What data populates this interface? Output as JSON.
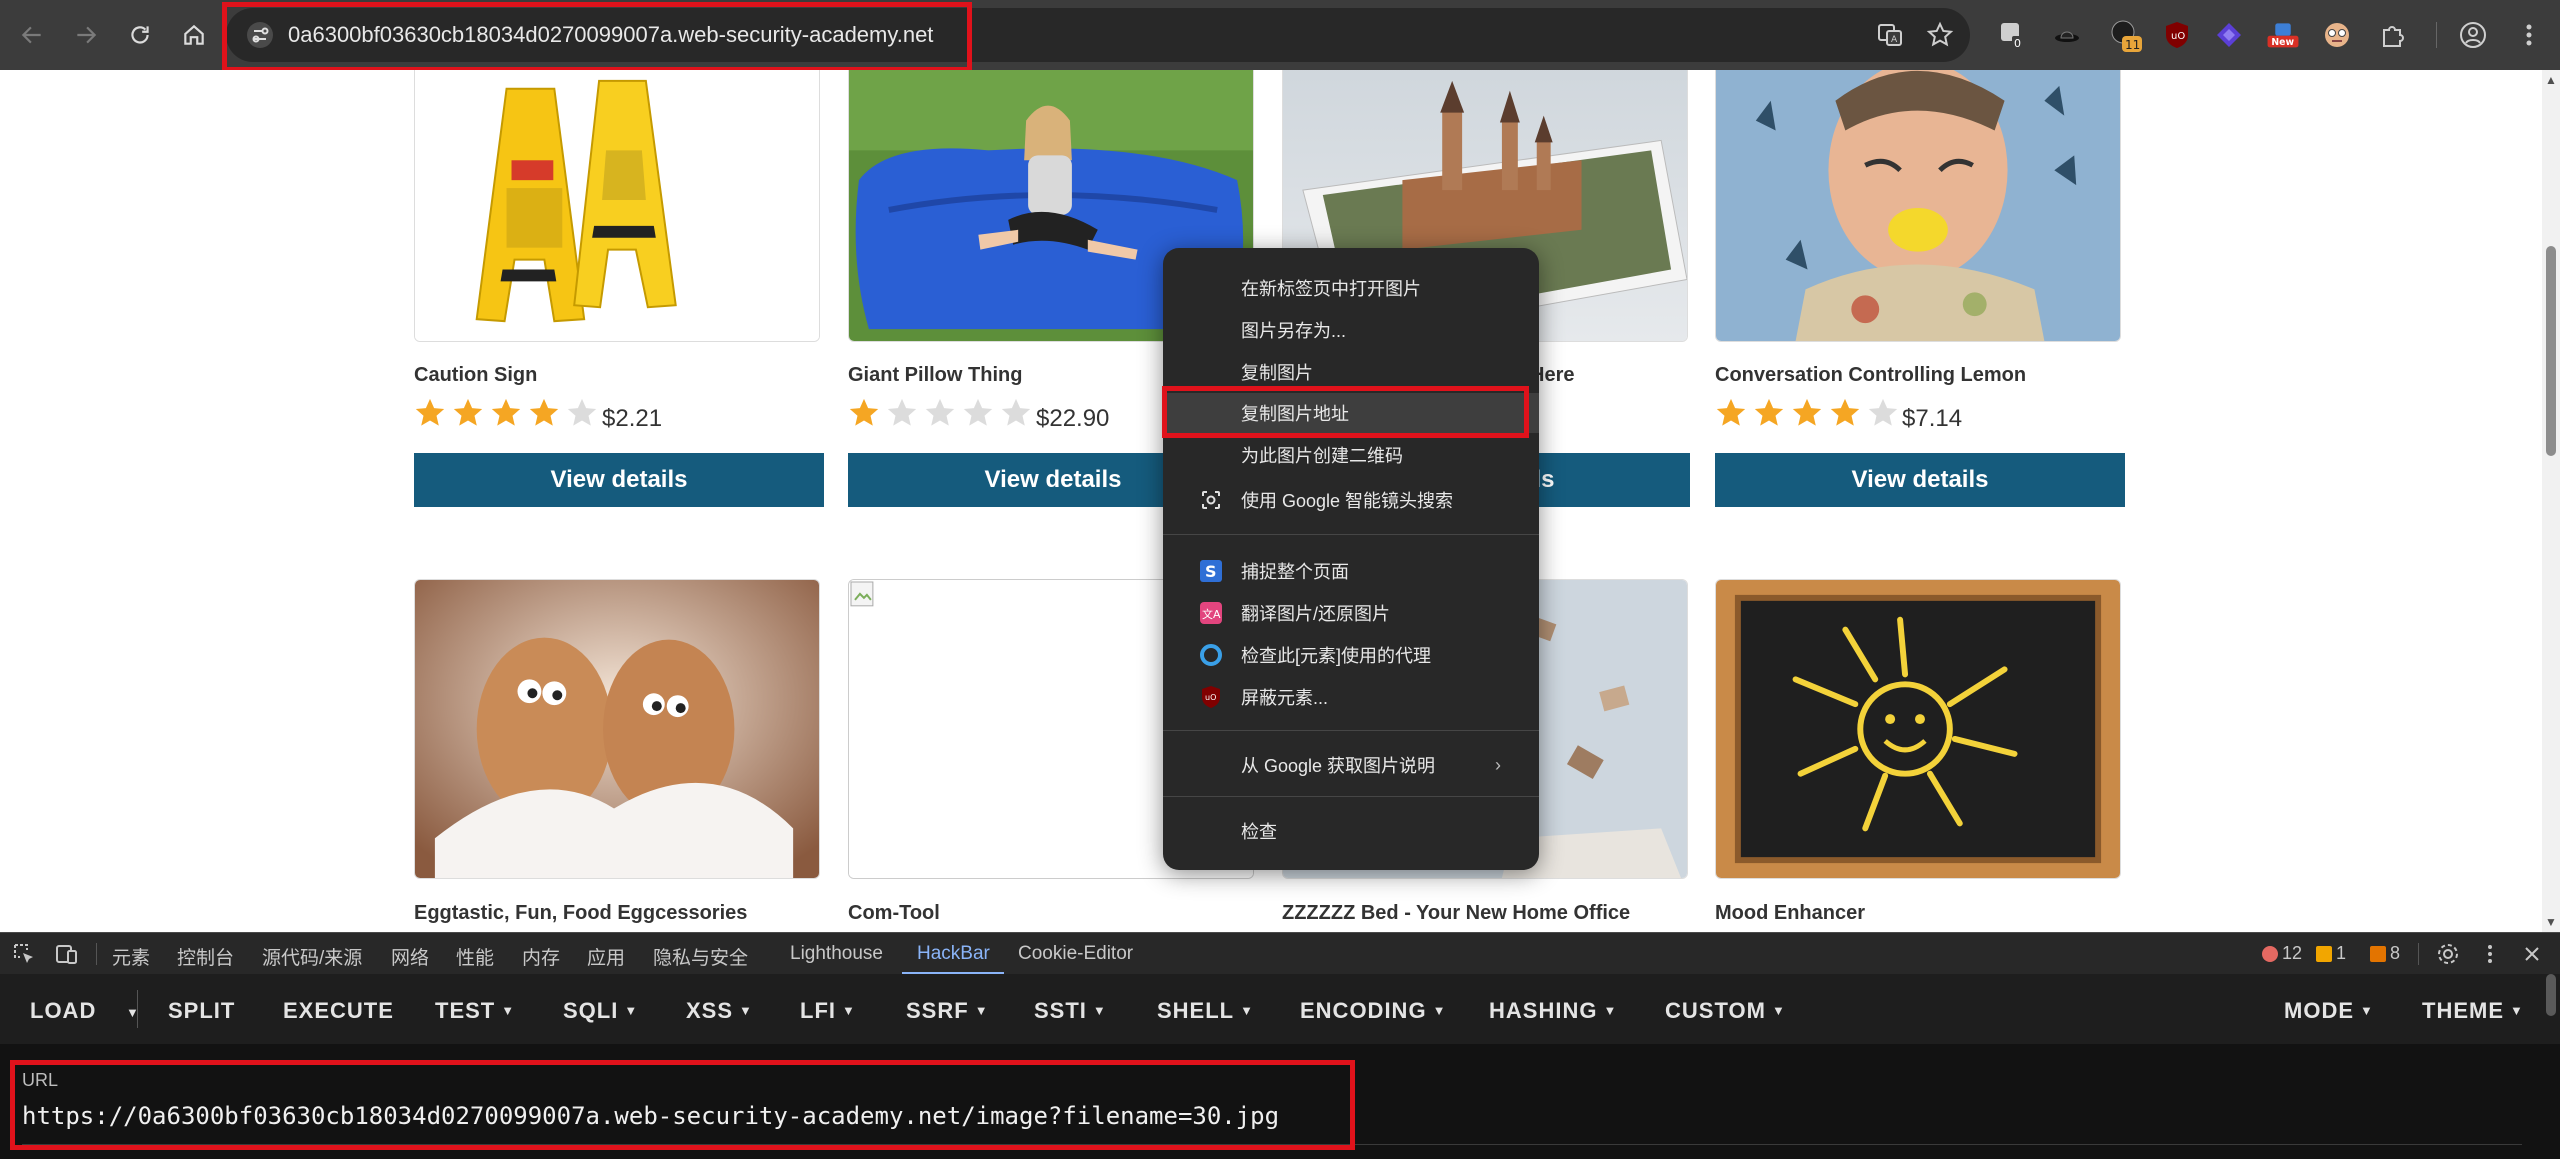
{
  "browser": {
    "address": "0a6300bf03630cb18034d0270099007a.web-security-academy.net",
    "extensions": [
      {
        "icon": "ext-badge-icon",
        "badge": "0"
      },
      {
        "icon": "ext-hat-icon",
        "badge": ""
      },
      {
        "icon": "ext-avatar-icon",
        "badge": "11"
      },
      {
        "icon": "ublock-icon",
        "badge": ""
      },
      {
        "icon": "ext-diamond-icon",
        "badge": ""
      },
      {
        "icon": "ext-new-icon",
        "badge": "New"
      },
      {
        "icon": "ext-face-icon",
        "badge": ""
      }
    ]
  },
  "products": [
    {
      "title": "Caution Sign",
      "price": "$2.21",
      "rating": 4,
      "button": "View details"
    },
    {
      "title": "Giant Pillow Thing",
      "price": "$22.90",
      "rating": 1,
      "button": "View details"
    },
    {
      "title": "Here",
      "price": "",
      "rating": 0,
      "button": "View details"
    },
    {
      "title": "Conversation Controlling Lemon",
      "price": "$7.14",
      "rating": 4,
      "button": "View details"
    },
    {
      "title": "Eggtastic, Fun, Food Eggcessories"
    },
    {
      "title": "Com-Tool"
    },
    {
      "title": "ZZZZZZ Bed - Your New Home Office"
    },
    {
      "title": "Mood Enhancer"
    }
  ],
  "context_menu": {
    "items": [
      "在新标签页中打开图片",
      "图片另存为...",
      "复制图片",
      "复制图片地址",
      "为此图片创建二维码",
      "使用 Google 智能镜头搜索",
      "捕捉整个页面",
      "翻译图片/还原图片",
      "检查此[元素]使用的代理",
      "屏蔽元素...",
      "从 Google 获取图片说明",
      "检查"
    ],
    "highlighted": "复制图片地址"
  },
  "devtools": {
    "tabs": [
      "元素",
      "控制台",
      "源代码/来源",
      "网络",
      "性能",
      "内存",
      "应用",
      "隐私与安全",
      "Lighthouse",
      "HackBar",
      "Cookie-Editor"
    ],
    "active_tab": "HackBar",
    "errors": "12",
    "warnings": "1",
    "issues": "8"
  },
  "hackbar": {
    "buttons": [
      "LOAD",
      "SPLIT",
      "EXECUTE",
      "TEST",
      "SQLI",
      "XSS",
      "LFI",
      "SSRF",
      "SSTI",
      "SHELL",
      "ENCODING",
      "HASHING",
      "CUSTOM",
      "MODE",
      "THEME"
    ],
    "url_label": "URL",
    "url_value": "https://0a6300bf03630cb18034d0270099007a.web-security-academy.net/image?filename=30.jpg"
  },
  "colors": {
    "accent_button": "#155b7d",
    "highlight_box": "#e0121b",
    "star_filled": "#f5a623",
    "star_empty": "#dcdcdc"
  }
}
